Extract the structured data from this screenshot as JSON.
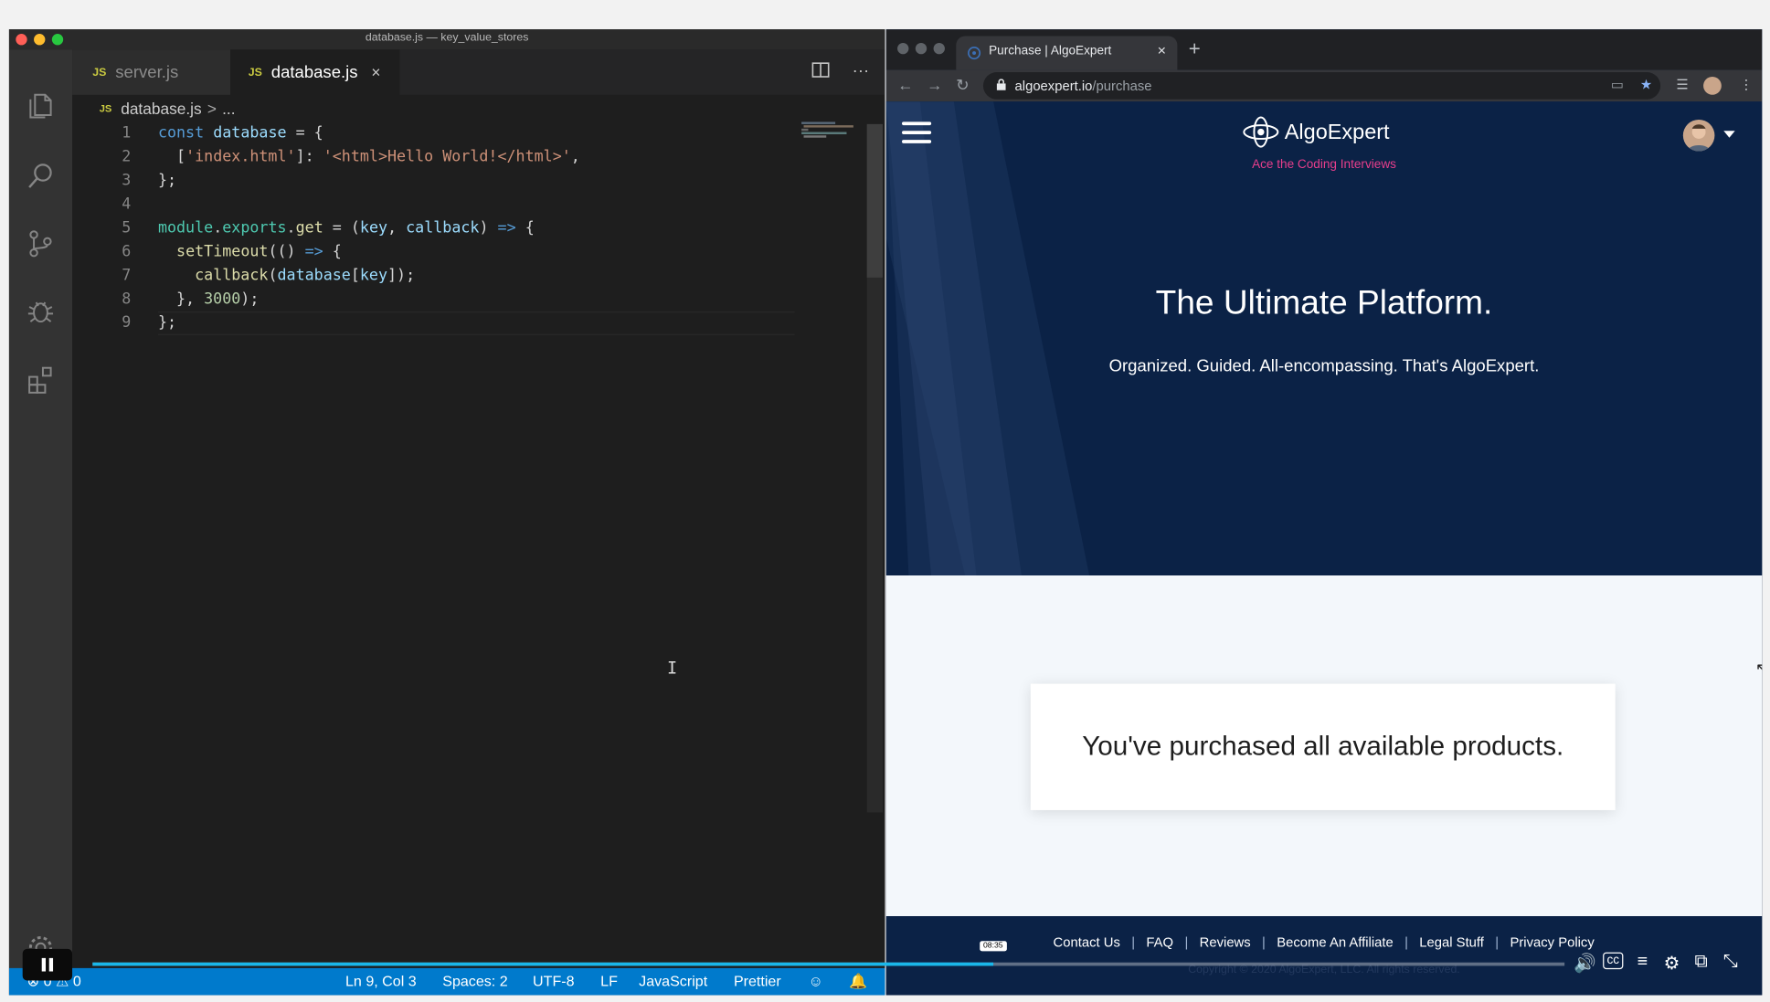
{
  "vscode": {
    "window_title": "database.js — key_value_stores",
    "tabs": [
      {
        "icon": "JS",
        "label": "server.js",
        "active": false
      },
      {
        "icon": "JS",
        "label": "database.js",
        "active": true,
        "close": "×"
      }
    ],
    "tab_actions": [
      "split-editor-icon",
      "more-actions-icon"
    ],
    "more_label": "···",
    "breadcrumb": {
      "icon": "JS",
      "file": "database.js",
      "sep": ">",
      "more": "..."
    },
    "code_lines": [
      {
        "n": "1"
      },
      {
        "n": "2"
      },
      {
        "n": "3"
      },
      {
        "n": "4"
      },
      {
        "n": "5"
      },
      {
        "n": "6"
      },
      {
        "n": "7"
      },
      {
        "n": "8"
      },
      {
        "n": "9"
      }
    ],
    "code": {
      "l1": [
        "const",
        " ",
        "database",
        " = {"
      ],
      "l2": [
        "  [",
        "'index.html'",
        "]: ",
        "'<html>Hello World!</html>'",
        ","
      ],
      "l3": [
        "};"
      ],
      "l5": [
        "module",
        ".",
        "exports",
        ".",
        "get",
        " = (",
        "key",
        ", ",
        "callback",
        ") ",
        "=>",
        " {"
      ],
      "l6": [
        "  ",
        "setTimeout",
        "(() ",
        "=>",
        " {"
      ],
      "l7": [
        "    ",
        "callback",
        "(",
        "database",
        "[",
        "key",
        "]);"
      ],
      "l8": [
        "  }, ",
        "3000",
        ");"
      ],
      "l9": [
        "};"
      ]
    },
    "status": {
      "errors": "0",
      "warnings": "0",
      "position": "Ln 9, Col 3",
      "spaces": "Spaces: 2",
      "encoding": "UTF-8",
      "eol": "LF",
      "language": "JavaScript",
      "formatter": "Prettier"
    },
    "colors": {
      "accent": "#007acc",
      "background": "#1e1e1e",
      "activity": "#333333"
    }
  },
  "chrome": {
    "tab_title": "Purchase | AlgoExpert",
    "tab_close": "×",
    "new_tab": "+",
    "url_host": "algoexpert.io",
    "url_path": "/purchase",
    "nav": {
      "back": "←",
      "forward": "→",
      "reload": "↻"
    }
  },
  "page": {
    "logo_text": "AlgoExpert",
    "tagline": "Ace the Coding Interviews",
    "hero_title": "The Ultimate Platform.",
    "hero_subtitle": "Organized. Guided. All-encompassing. That's AlgoExpert.",
    "card_message": "You've purchased all available products.",
    "footer_links": [
      "Contact Us",
      "FAQ",
      "Reviews",
      "Become An Affiliate",
      "Legal Stuff",
      "Privacy Policy"
    ],
    "footer_sep": "|",
    "copyright": "Copyright © 2020 AlgoExpert, LLC. All rights reserved.",
    "colors": {
      "navy": "#0b2246",
      "pink": "#e83e8c",
      "light": "#f3f7fb"
    }
  },
  "player": {
    "time": "08:35",
    "progress": 0.612,
    "controls": [
      "volume-icon",
      "captions-icon",
      "transcript-icon",
      "settings-icon",
      "pip-icon",
      "exit-fullscreen-icon"
    ]
  }
}
